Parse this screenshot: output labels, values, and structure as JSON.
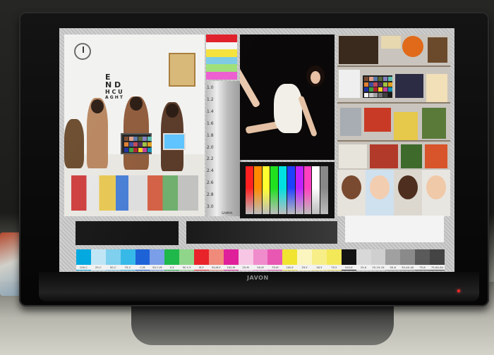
{
  "monitor": {
    "brand": "JAVON",
    "power_led_color": "#ff2a2a"
  },
  "test_pattern": {
    "eye_chart_lines": [
      "E",
      "N D",
      "H C U",
      "A G H T"
    ],
    "gamma_labels": [
      "1.0",
      "1.2",
      "1.4",
      "1.6",
      "1.8",
      "2.0",
      "2.2",
      "2.4",
      "2.6",
      "2.8",
      "3.0"
    ],
    "gamma_footer": "GAMMA",
    "color_bars": [
      "#e0202a",
      "#f5f5f5",
      "#f4e23c",
      "#7ecbe6",
      "#9fe07a",
      "#ec5fd0"
    ],
    "rainbow_bars": [
      "#ff2020",
      "#ff8a00",
      "#ffff30",
      "#20e020",
      "#00e0e0",
      "#2040ff",
      "#c020ff",
      "#ff40c0",
      "#ffffff",
      "#888888"
    ],
    "swatches": [
      {
        "label": "100-C",
        "color": "#00a8e0"
      },
      {
        "label": "25-C",
        "color": "#bfe6f5"
      },
      {
        "label": "50-C",
        "color": "#7dd0ee"
      },
      {
        "label": "75-C",
        "color": "#36b9e8"
      },
      {
        "label": "C-M",
        "color": "#1e62d8"
      },
      {
        "label": "50 C-M",
        "color": "#7a9ee8"
      },
      {
        "label": "G-Y",
        "color": "#1fb84a"
      },
      {
        "label": "50 C-Y",
        "color": "#8fd68a"
      },
      {
        "label": "M-Y",
        "color": "#e8242a"
      },
      {
        "label": "50-M-Y",
        "color": "#f08a7a"
      },
      {
        "label": "100-M",
        "color": "#e0209a"
      },
      {
        "label": "25-M",
        "color": "#f6c6e4"
      },
      {
        "label": "50-M",
        "color": "#f08ccc"
      },
      {
        "label": "75-M",
        "color": "#e858b2"
      },
      {
        "label": "100-Y",
        "color": "#f0e430"
      },
      {
        "label": "25-Y",
        "color": "#fbf5c0"
      },
      {
        "label": "50-Y",
        "color": "#f7ee88"
      },
      {
        "label": "75-Y",
        "color": "#f3e858"
      },
      {
        "label": "100-K",
        "color": "#141414"
      },
      {
        "label": "25-K",
        "color": "#d8d8d8"
      },
      {
        "label": "25-19-19",
        "color": "#cfcfcf"
      },
      {
        "label": "50-K",
        "color": "#a0a0a0"
      },
      {
        "label": "50-40-40",
        "color": "#8a8a8a"
      },
      {
        "label": "75-K",
        "color": "#5a5a5a"
      },
      {
        "label": "75-64-64",
        "color": "#444444"
      }
    ]
  }
}
